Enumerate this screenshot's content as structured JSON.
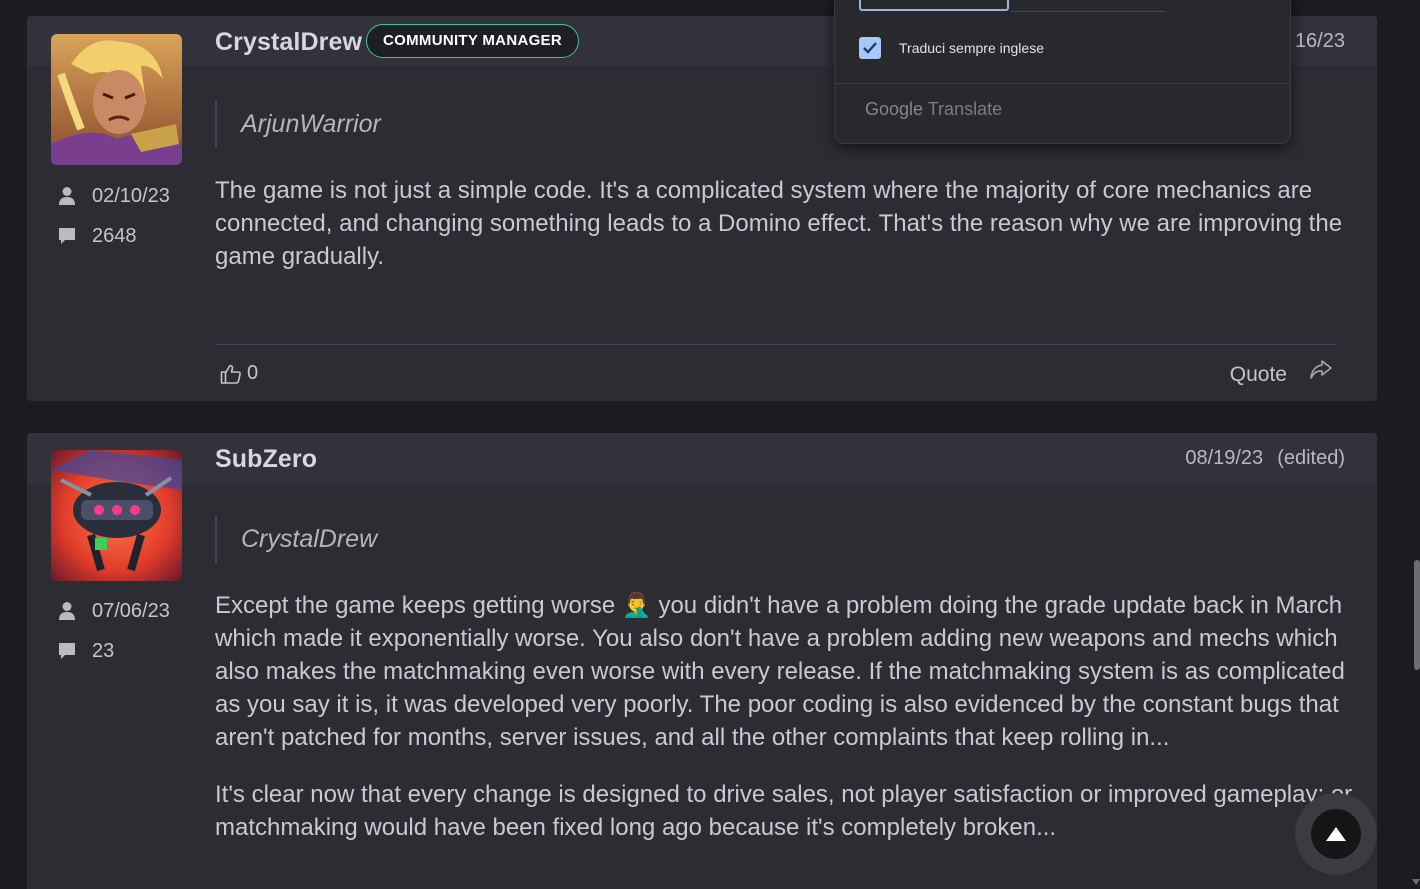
{
  "posts": [
    {
      "username": "CrystalDrew",
      "badge": "COMMUNITY MANAGER",
      "date": "16/23",
      "join_date": "02/10/23",
      "post_count": "2648",
      "quoted_user": "ArjunWarrior",
      "paragraphs": [
        "The game is not just a simple code. It's a complicated system where the majority of core mechanics are connected, and changing something leads to a Domino effect. That's the reason why we are improving the game gradually."
      ],
      "likes": "0",
      "quote_label": "Quote"
    },
    {
      "username": "SubZero",
      "date": "08/19/23",
      "edited": "(edited)",
      "join_date": "07/06/23",
      "post_count": "23",
      "quoted_user": "CrystalDrew",
      "paragraphs": [
        "Except the game keeps getting worse 🤦‍♂️ you didn't have a problem doing the grade update back in March which made it exponentially worse. You also don't have a problem adding new weapons and mechs which also makes the matchmaking even worse with every release. If the matchmaking system is as complicated as you say it is, it was developed very poorly. The poor coding is also evidenced by the constant bugs that aren't patched for months, server issues, and all the other complaints that keep rolling in...",
        "It's clear now that every change is designed to drive sales, not player satisfaction or improved gameplay; or matchmaking would have been fixed long ago because it's completely broken..."
      ]
    }
  ],
  "translate_popup": {
    "option_label": "Traduci sempre inglese",
    "option_checked": true,
    "brand": "Google",
    "product": "Translate"
  },
  "icons": {
    "join_date": "user-icon",
    "post_count": "comment-icon",
    "like": "thumbs-up-icon",
    "share": "share-arrow-icon",
    "scroll_top": "triangle-up-icon",
    "checkbox": "checkmark-icon"
  },
  "colors": {
    "badge_border": "#3cc29a",
    "checkbox": "#a8c7fa",
    "post_bg": "#2c2d33",
    "page_bg": "#1b1c1f"
  }
}
